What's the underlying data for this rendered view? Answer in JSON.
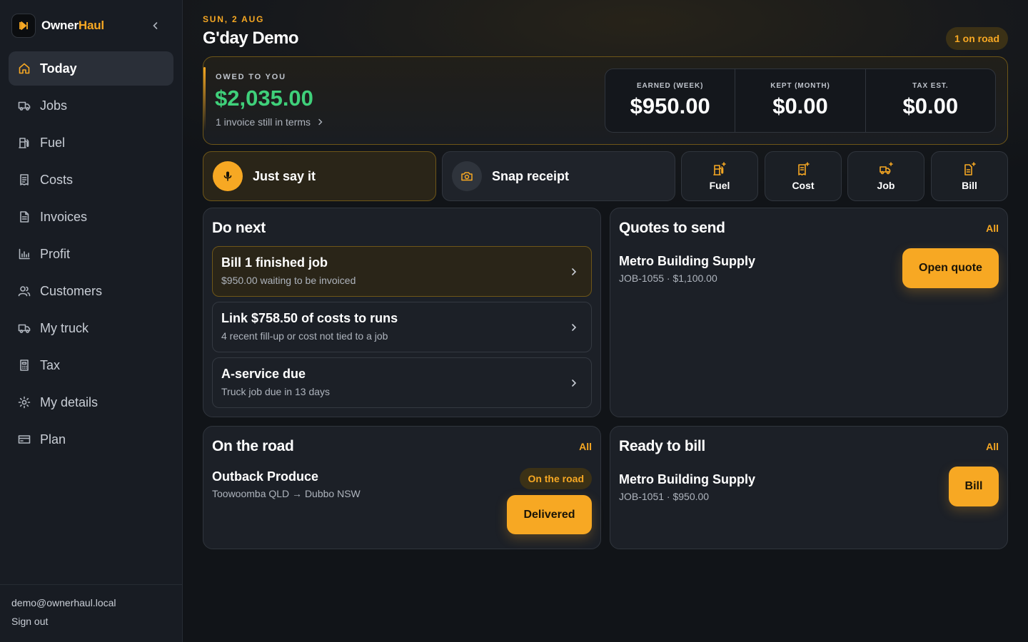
{
  "brand": {
    "name_main": "Owner",
    "name_accent": "Haul"
  },
  "nav": [
    {
      "label": "Today",
      "icon": "home-icon",
      "active": true
    },
    {
      "label": "Jobs",
      "icon": "truck-icon"
    },
    {
      "label": "Fuel",
      "icon": "fuel-pump-icon"
    },
    {
      "label": "Costs",
      "icon": "receipt-icon"
    },
    {
      "label": "Invoices",
      "icon": "document-icon"
    },
    {
      "label": "Profit",
      "icon": "bar-chart-icon"
    },
    {
      "label": "Customers",
      "icon": "users-icon"
    },
    {
      "label": "My truck",
      "icon": "truck-icon"
    },
    {
      "label": "Tax",
      "icon": "calculator-icon"
    },
    {
      "label": "My details",
      "icon": "settings-icon"
    },
    {
      "label": "Plan",
      "icon": "credit-card-icon"
    }
  ],
  "user": {
    "email": "demo@ownerhaul.local",
    "signout": "Sign out"
  },
  "header": {
    "date": "SUN, 2 AUG",
    "greeting": "G'day Demo",
    "road_badge": "1 on road"
  },
  "owed": {
    "label": "OWED TO YOU",
    "amount": "$2,035.00",
    "sub": "1 invoice still in terms",
    "stats": [
      {
        "label": "EARNED (WEEK)",
        "value": "$950.00"
      },
      {
        "label": "KEPT (MONTH)",
        "value": "$0.00"
      },
      {
        "label": "TAX EST.",
        "value": "$0.00"
      }
    ]
  },
  "quick_actions": {
    "voice": "Just say it",
    "snap": "Snap receipt",
    "fuel": "Fuel",
    "cost": "Cost",
    "job": "Job",
    "bill": "Bill"
  },
  "do_next": {
    "title": "Do next",
    "tasks": [
      {
        "title": "Bill 1 finished job",
        "sub": "$950.00 waiting to be invoiced"
      },
      {
        "title": "Link $758.50 of costs to runs",
        "sub": "4 recent fill-up or cost not tied to a job"
      },
      {
        "title": "A-service due",
        "sub": "Truck job due in 13 days"
      }
    ]
  },
  "quotes": {
    "title": "Quotes to send",
    "all": "All",
    "item": {
      "name": "Metro Building Supply",
      "sub": "JOB-1055 · $1,100.00",
      "button": "Open quote"
    }
  },
  "on_road": {
    "title": "On the road",
    "all": "All",
    "item": {
      "name": "Outback Produce",
      "route": "Toowoomba QLD → Dubbo NSW",
      "status": "On the road",
      "button": "Delivered"
    }
  },
  "ready_bill": {
    "title": "Ready to bill",
    "all": "All",
    "item": {
      "name": "Metro Building Supply",
      "sub": "JOB-1051 · $950.00",
      "button": "Bill"
    }
  },
  "colors": {
    "accent": "#f7a823",
    "positive": "#3fd07a",
    "background": "#111418",
    "card": "#1c2027"
  }
}
